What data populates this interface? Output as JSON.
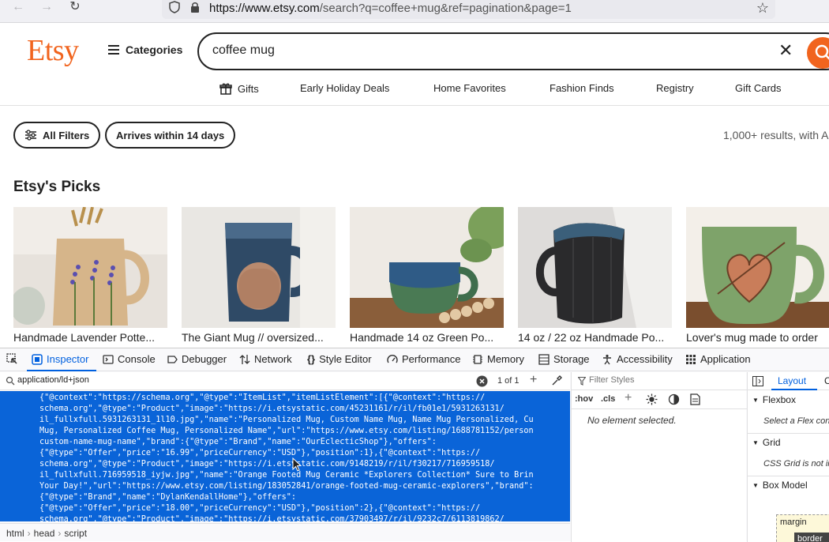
{
  "browser": {
    "url_host": "https://www.etsy.com",
    "url_path": "/search?q=coffee+mug&ref=pagination&page=1"
  },
  "header": {
    "logo": "Etsy",
    "categories_label": "Categories",
    "search_value": "coffee mug"
  },
  "nav": {
    "items": [
      "Gifts",
      "Early Holiday Deals",
      "Home Favorites",
      "Fashion Finds",
      "Registry",
      "Gift Cards"
    ]
  },
  "filters": {
    "all_filters": "All Filters",
    "arrives": "Arrives within 14 days",
    "results": "1,000+ results, with A"
  },
  "picks": {
    "title": "Etsy's Picks",
    "items": [
      {
        "title": "Handmade Lavender Potte..."
      },
      {
        "title": "The Giant Mug // oversized..."
      },
      {
        "title": "Handmade 14 oz Green Po..."
      },
      {
        "title": "14 oz / 22 oz Handmade Po..."
      },
      {
        "title": "Lover's mug made to order"
      }
    ]
  },
  "devtools": {
    "tabs": [
      "Inspector",
      "Console",
      "Debugger",
      "Network",
      "Style Editor",
      "Performance",
      "Memory",
      "Storage",
      "Accessibility",
      "Application"
    ],
    "search_value": "application/ld+json",
    "match_count": "1 of 1",
    "markup_lines": [
      "{\"@context\":\"https://schema.org\",\"@type\":\"ItemList\",\"itemListElement\":[{\"@context\":\"https://",
      "schema.org\",\"@type\":\"Product\",\"image\":\"https://i.etsystatic.com/45231161/r/il/fb01e1/5931263131/",
      "il_fullxfull.5931263131_1l10.jpg\",\"name\":\"Personalized Mug, Custom Name Mug, Name Mug Personalized, Cu",
      "Mug, Personalized Coffee Mug, Personalized Name\",\"url\":\"https://www.etsy.com/listing/1688781152/person",
      "custom-name-mug-name\",\"brand\":{\"@type\":\"Brand\",\"name\":\"OurEclecticShop\"},\"offers\":",
      "{\"@type\":\"Offer\",\"price\":\"16.99\",\"priceCurrency\":\"USD\"},\"position\":1},{\"@context\":\"https://",
      "schema.org\",\"@type\":\"Product\",\"image\":\"https://i.etsystatic.com/9148219/r/il/f30217/716959518/",
      "il_fullxfull.716959518_iyjw.jpg\",\"name\":\"Orange Footed Mug Ceramic *Explorers Collection* Sure to Brin",
      "Your Day!\",\"url\":\"https://www.etsy.com/listing/183052841/orange-footed-mug-ceramic-explorers\",\"brand\":",
      "{\"@type\":\"Brand\",\"name\":\"DylanKendallHome\"},\"offers\":",
      "{\"@type\":\"Offer\",\"price\":\"18.00\",\"priceCurrency\":\"USD\"},\"position\":2},{\"@context\":\"https://",
      "schema.org\",\"@type\":\"Product\",\"image\":\"https://i.etsystatic.com/37903497/r/il/9232c7/6113819862/"
    ],
    "breadcrumbs": [
      "html",
      "head",
      "script"
    ],
    "rules": {
      "filter_placeholder": "Filter Styles",
      "hov": ":hov",
      "cls": ".cls",
      "empty": "No element selected."
    },
    "layout": {
      "tab_layout": "Layout",
      "tab_c": "C",
      "flexbox": "Flexbox",
      "flexbox_note": "Select a Flex con",
      "grid": "Grid",
      "grid_note": "CSS Grid is not in",
      "box_model": "Box Model",
      "margin": "margin",
      "border": "border"
    }
  }
}
